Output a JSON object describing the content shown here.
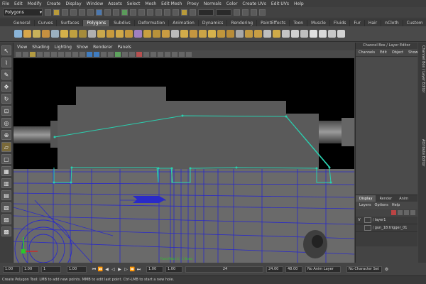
{
  "menubar": [
    "File",
    "Edit",
    "Modify",
    "Create",
    "Display",
    "Window",
    "Assets",
    "Select",
    "Mesh",
    "Edit Mesh",
    "Proxy",
    "Normals",
    "Color",
    "Create UVs",
    "Edit UVs",
    "Help"
  ],
  "status": {
    "mode": "Polygons"
  },
  "shelf_tabs": [
    "General",
    "Curves",
    "Surfaces",
    "Polygons",
    "Subdivs",
    "Deformation",
    "Animation",
    "Dynamics",
    "Rendering",
    "PaintEffects",
    "Toon",
    "Muscle",
    "Fluids",
    "Fur",
    "Hair",
    "nCloth",
    "Custom"
  ],
  "shelf_active": "Polygons",
  "panel_menu": [
    "View",
    "Shading",
    "Lighting",
    "Show",
    "Renderer",
    "Panels"
  ],
  "viewport": {
    "overlay_text": "Front Mesh 4 | 1 Views"
  },
  "channel_box": {
    "title": "Channel Box / Layer Editor",
    "menu": [
      "Channels",
      "Edit",
      "Object",
      "Show"
    ]
  },
  "layer_editor": {
    "tabs": [
      "Display",
      "Render",
      "Anim"
    ],
    "menu": [
      "Layers",
      "Options",
      "Help"
    ],
    "layers": [
      {
        "visible": "V",
        "name": "layer1"
      },
      {
        "visible": "",
        "name": "gun_18:trigger_01"
      }
    ]
  },
  "side_tabs": [
    "Channel Box / Layer Editor",
    "Attribute Editor"
  ],
  "range": {
    "start": "1.00",
    "current": "1.00",
    "frame": "1",
    "range_start": "1.00",
    "range_end": "24",
    "end": "24.00",
    "end_max": "48.00",
    "anim_layer": "No Anim Layer",
    "char_set": "No Character Set"
  },
  "help_line": "Create Polygon Tool: LMB to add new points. MMB to edit last point. Ctrl-LMB to start a new hole."
}
